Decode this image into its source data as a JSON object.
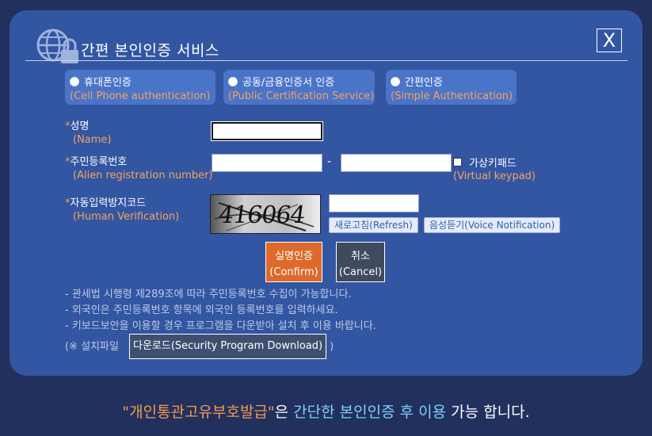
{
  "modal": {
    "title": "간편 본인인증 서비스",
    "close_label": "X"
  },
  "auth_options": [
    {
      "label": "휴대폰인증",
      "sub": "(Cell Phone authentication)"
    },
    {
      "label": "공동/금융인증서 인증",
      "sub": "(Public Certification Service)"
    },
    {
      "label": "간편인증",
      "sub": "(Simple Authentication)"
    }
  ],
  "form": {
    "name": {
      "star": "*",
      "label": "성명",
      "sub": "(Name)",
      "value": ""
    },
    "rrn": {
      "star": "*",
      "label": "주민등록번호",
      "sub": "(Alien registration number)",
      "value1": "",
      "value2": "",
      "separator": "-"
    },
    "virtual_keypad": {
      "label": "가상키패드",
      "sub": "(Virtual keypad)"
    },
    "captcha": {
      "star": "*",
      "label": "자동입력방지코드",
      "sub": "(Human Verification)",
      "image_text": "416064",
      "value": ""
    }
  },
  "buttons": {
    "refresh": "새로고침(Refresh)",
    "voice": "음성듣기(Voice Notification)",
    "confirm_line1": "실명인증",
    "confirm_line2": "(Confirm)",
    "cancel_line1": "취소",
    "cancel_line2": "(Cancel)"
  },
  "notes": [
    "- 관세법 시행령 제289조에 따라 주민등록번호 수집이 가능합니다.",
    "- 외국인은 주민등록번호 항목에 외국인 등록번호를 입력하세요.",
    "- 키보드보안을 이용할 경우 프로그램을 다운받아 설치 후 이용 바랍니다."
  ],
  "download": {
    "prefix": "(※ 설치파일",
    "button": "다운로드(Security Program Download)",
    "suffix": ")"
  },
  "bottom_message": {
    "part1": "\"개인통관고유부호발급\"",
    "part2": "은 ",
    "part3": "간단한 본인인증 후 이용",
    "part4": " 가능 합니다."
  },
  "colors": {
    "background": "#22305e",
    "modal": "#3356a2",
    "option": "#4a74c8",
    "accent_orange": "#f39a4d",
    "confirm": "#dd6a2a",
    "cancel": "#3f4a5e"
  },
  "icons": {
    "logo": "globe-lock-icon",
    "radio": "radio-icon",
    "checkbox": "checkbox-icon"
  }
}
